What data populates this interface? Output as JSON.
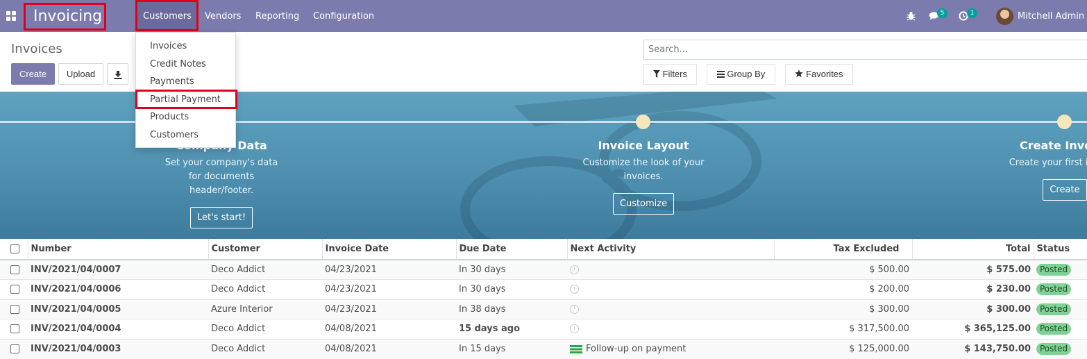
{
  "app": {
    "title": "Invoicing",
    "menu": [
      "Customers",
      "Vendors",
      "Reporting",
      "Configuration"
    ],
    "messages_badge": "5",
    "activities_badge": "1",
    "user_name": "Mitchell Admin"
  },
  "dropdown": {
    "items": [
      "Invoices",
      "Credit Notes",
      "Payments",
      "Partial Payment",
      "Products",
      "Customers"
    ]
  },
  "control": {
    "page_title": "Invoices",
    "create_label": "Create",
    "upload_label": "Upload",
    "search_placeholder": "Search...",
    "filters_label": "Filters",
    "group_by_label": "Group By",
    "favorites_label": "Favorites"
  },
  "banner": {
    "steps": [
      {
        "title": "Company Data",
        "desc": "Set your company's data for documents header/footer.",
        "button": "Let's start!"
      },
      {
        "title": "Invoice Layout",
        "desc": "Customize the look of your invoices.",
        "button": "Customize"
      },
      {
        "title": "Create Invoice",
        "desc": "Create your first invoice.",
        "button": "Create"
      }
    ]
  },
  "table": {
    "columns": [
      "Number",
      "Customer",
      "Invoice Date",
      "Due Date",
      "Next Activity",
      "Tax Excluded",
      "Total",
      "Status"
    ],
    "rows": [
      {
        "number": "INV/2021/04/0007",
        "customer": "Deco Addict",
        "invoice_date": "04/23/2021",
        "due_date": "In 30 days",
        "due_late": false,
        "activity": "",
        "tax_excluded": "$ 500.00",
        "total": "$ 575.00",
        "status": "Posted"
      },
      {
        "number": "INV/2021/04/0006",
        "customer": "Deco Addict",
        "invoice_date": "04/23/2021",
        "due_date": "In 30 days",
        "due_late": false,
        "activity": "",
        "tax_excluded": "$ 200.00",
        "total": "$ 230.00",
        "status": "Posted"
      },
      {
        "number": "INV/2021/04/0005",
        "customer": "Azure Interior",
        "invoice_date": "04/23/2021",
        "due_date": "In 38 days",
        "due_late": false,
        "activity": "",
        "tax_excluded": "$ 300.00",
        "total": "$ 300.00",
        "status": "Posted"
      },
      {
        "number": "INV/2021/04/0004",
        "customer": "Deco Addict",
        "invoice_date": "04/08/2021",
        "due_date": "15 days ago",
        "due_late": true,
        "activity": "",
        "tax_excluded": "$ 317,500.00",
        "total": "$ 365,125.00",
        "status": "Posted"
      },
      {
        "number": "INV/2021/04/0003",
        "customer": "Deco Addict",
        "invoice_date": "04/08/2021",
        "due_date": "In 15 days",
        "due_late": false,
        "activity": "Follow-up on payment",
        "tax_excluded": "$ 125,000.00",
        "total": "$ 143,750.00",
        "status": "Posted"
      }
    ]
  },
  "colors": {
    "brand": "#7c7bad",
    "highlight": "#e0001b",
    "status_posted": "#7fd196",
    "overdue": "#c4222f"
  }
}
